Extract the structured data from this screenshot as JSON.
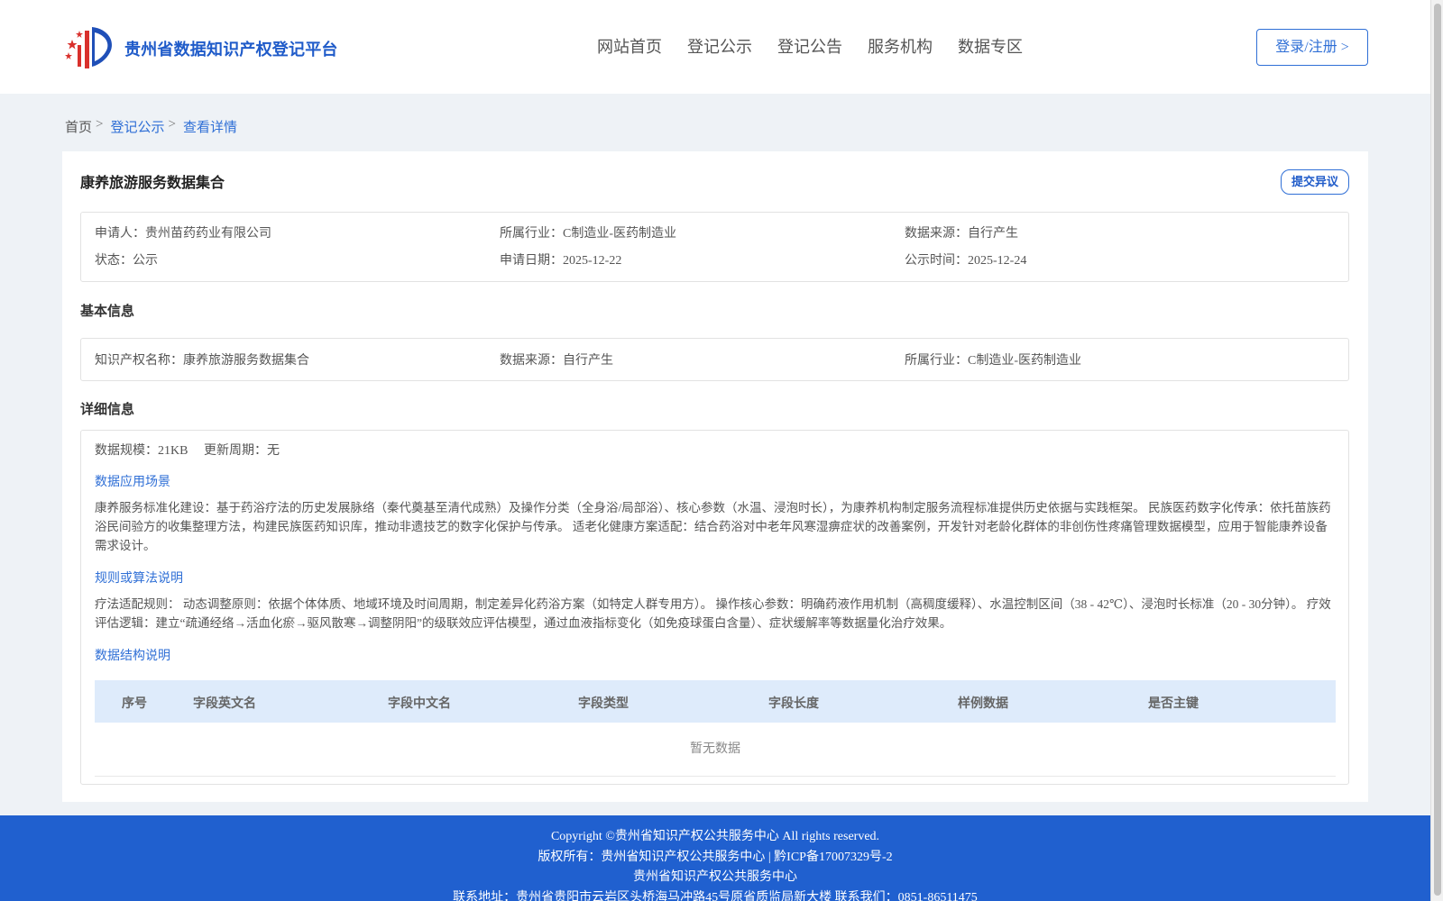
{
  "header": {
    "brand": "贵州省数据知识产权登记平台",
    "nav": [
      "网站首页",
      "登记公示",
      "登记公告",
      "服务机构",
      "数据专区"
    ],
    "login": "登录/注册 >"
  },
  "breadcrumb": {
    "home": "首页",
    "sep": ">",
    "level2": "登记公示",
    "current": "查看详情"
  },
  "detail": {
    "title": "康养旅游服务数据集合",
    "objection_btn": "提交异议",
    "summary": {
      "applicant_label": "申请人：",
      "applicant": "贵州苗药药业有限公司",
      "industry_label": "所属行业：",
      "industry": "C制造业-医药制造业",
      "source_label": "数据来源：",
      "source": "自行产生",
      "status_label": "状态：",
      "status": "公示",
      "apply_date_label": "申请日期：",
      "apply_date": "2025-12-22",
      "publish_date_label": "公示时间：",
      "publish_date": "2025-12-24"
    },
    "basic": {
      "heading": "基本信息",
      "ip_name_label": "知识产权名称：",
      "ip_name": "康养旅游服务数据集合",
      "source_label": "数据来源：",
      "source": "自行产生",
      "industry_label": "所属行业：",
      "industry": "C制造业-医药制造业"
    },
    "extra": {
      "heading": "详细信息",
      "scale_label": "数据规模：",
      "scale": "21KB",
      "cycle_label": "更新周期：",
      "cycle": "无",
      "scenario_heading": "数据应用场景",
      "scenario_text": "康养服务标准化建设：基于药浴疗法的历史发展脉络（秦代奠基至清代成熟）及操作分类（全身浴/局部浴）、核心参数（水温、浸泡时长），为康养机构制定服务流程标准提供历史依据与实践框架。 民族医药数字化传承：依托苗族药浴民间验方的收集整理方法，构建民族医药知识库，推动非遗技艺的数字化保护与传承。 适老化健康方案适配：结合药浴对中老年风寒湿痹症状的改善案例，开发针对老龄化群体的非创伤性疼痛管理数据模型，应用于智能康养设备需求设计。",
      "rule_heading": "规则或算法说明",
      "rule_text": "疗法适配规则： 动态调整原则：依据个体体质、地域环境及时间周期，制定差异化药浴方案（如特定人群专用方）。 操作核心参数：明确药液作用机制（高稠度缓释）、水温控制区间（38 - 42℃）、浸泡时长标准（20 - 30分钟）。 疗效评估逻辑：建立“疏通经络→活血化瘀→驱风散寒→调整阴阳”的级联效应评估模型，通过血液指标变化（如免疫球蛋白含量）、症状缓解率等数据量化治疗效果。",
      "structure_heading": "数据结构说明",
      "table": {
        "columns": [
          "序号",
          "字段英文名",
          "字段中文名",
          "字段类型",
          "字段长度",
          "样例数据",
          "是否主键"
        ],
        "empty": "暂无数据"
      }
    }
  },
  "footer": {
    "copyright": "Copyright ©贵州省知识产权公共服务中心 All rights reserved.",
    "owner": "版权所有：贵州省知识产权公共服务中心 | 黔ICP备17007329号-2",
    "org": "贵州省知识产权公共服务中心",
    "contact": "联系地址：贵州省贵阳市云岩区头桥海马冲路45号原省质监局新大楼 联系我们：0851-86511475"
  },
  "colors": {
    "accent": "#2f6fd6",
    "footer_bg": "#2060cf",
    "table_head_bg": "#deebfb"
  }
}
